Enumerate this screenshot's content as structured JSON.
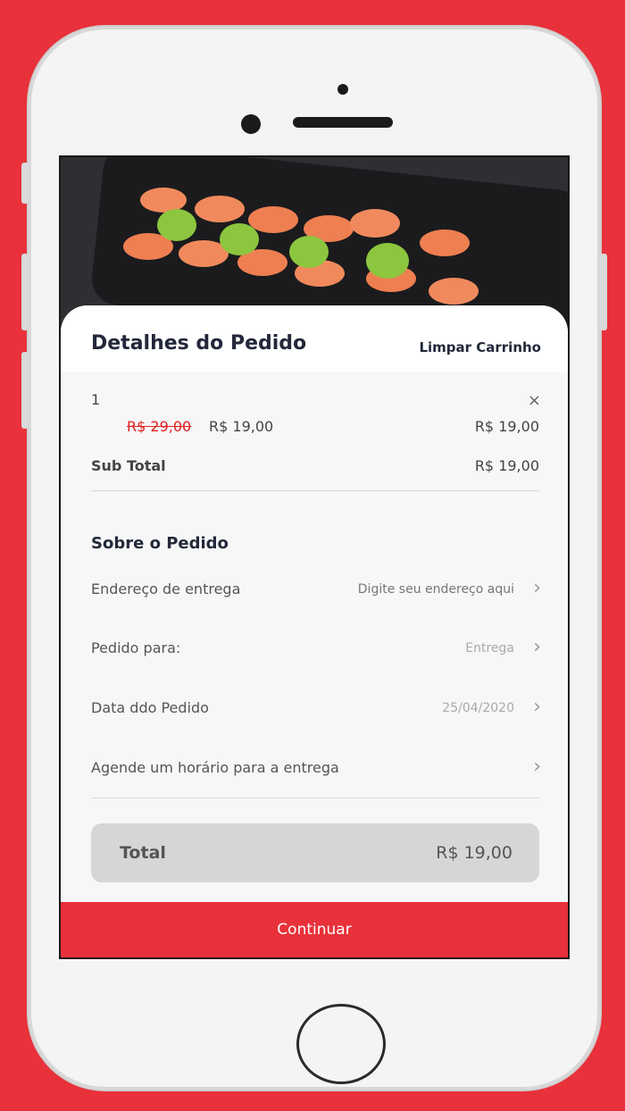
{
  "header": {
    "title": "Detalhes do Pedido",
    "clear_cart": "Limpar Carrinho"
  },
  "cart": {
    "quantity": "1",
    "close_icon": "×",
    "old_price": "R$ 29,00",
    "new_price": "R$ 19,00",
    "line_total": "R$ 19,00",
    "subtotal_label": "Sub Total",
    "subtotal_value": "R$ 19,00"
  },
  "order": {
    "section_title": "Sobre o Pedido",
    "rows": [
      {
        "label": "Endereço de entrega",
        "value": "Digite seu endereço aqui"
      },
      {
        "label": "Pedido para:",
        "value": "Entrega"
      },
      {
        "label": "Data ddo Pedido",
        "value": "25/04/2020"
      },
      {
        "label": "Agende um horário para a entrega",
        "value": ""
      }
    ],
    "chevron": "›"
  },
  "total": {
    "label": "Total",
    "value": "R$ 19,00"
  },
  "actions": {
    "continue_label": "Continuar"
  },
  "colors": {
    "accent": "#e8313a",
    "title": "#23283a",
    "strike": "#e02020"
  }
}
